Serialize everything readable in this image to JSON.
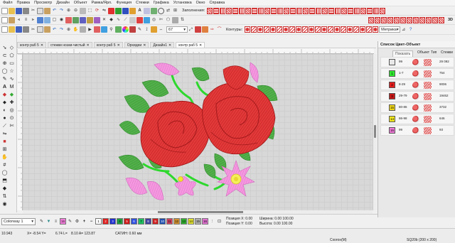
{
  "menu": [
    "Файл",
    "Правка",
    "Просмотр",
    "Дизайн",
    "Объект",
    "Рамка/Ярл.",
    "Функция",
    "Стежки",
    "Графика",
    "Установка",
    "Окно",
    "Справка"
  ],
  "toolbar": {
    "fill_label": "Заполнения:",
    "contour_label": "Контуры:",
    "zoom_value": "67",
    "units_value": "Метрика",
    "label_3d": "3D"
  },
  "tabs": [
    {
      "label": "контр раб 5",
      "active": false
    },
    {
      "label": "стежки ноэки-чистый",
      "active": false
    },
    {
      "label": "контр раб 5",
      "active": false
    },
    {
      "label": "Орхидеи",
      "active": false
    },
    {
      "label": "Дизайн1",
      "active": false
    },
    {
      "label": "контр раб 5",
      "active": true
    }
  ],
  "right_panel": {
    "title": "Список Цвет-Объект",
    "add_button": "Показать",
    "col_object": "Объект",
    "col_type": "Тип",
    "col_stitches": "Стежки",
    "rows": [
      {
        "seq": "99",
        "stitches": "29 092",
        "color": "#e8e8e8",
        "num": ""
      },
      {
        "seq": "1-7",
        "stitches": "754",
        "color": "#2ee62e",
        "num": "1"
      },
      {
        "seq": "8-29",
        "stitches": "9006",
        "color": "#e21d1d",
        "num": "2"
      },
      {
        "seq": "29-79",
        "stitches": "19462",
        "color": "#c41515",
        "num": "3"
      },
      {
        "seq": "80-86",
        "stitches": "3732",
        "color": "#eed61a",
        "num": "15"
      },
      {
        "seq": "86-98",
        "stitches": "646",
        "color": "#f2e81f",
        "num": "14"
      },
      {
        "seq": "99",
        "stitches": "93",
        "color": "#f07ad8",
        "num": "16"
      }
    ]
  },
  "colorbar": {
    "palette_select": "Colorway 1",
    "swatches": [
      {
        "num": "1",
        "color": "#ffffff"
      },
      {
        "num": "2",
        "color": "#e02020"
      },
      {
        "num": "3",
        "color": "#2030d0"
      },
      {
        "num": "4",
        "color": "#20a040"
      },
      {
        "num": "5",
        "color": "#d01818"
      },
      {
        "num": "6",
        "color": "#3050e0"
      },
      {
        "num": "7",
        "color": "#20c060"
      },
      {
        "num": "8",
        "color": "#4040a0"
      },
      {
        "num": "9",
        "color": "#d02020"
      },
      {
        "num": "10",
        "color": "#2050b0"
      },
      {
        "num": "11",
        "color": "#d04060"
      },
      {
        "num": "12",
        "color": "#d09030"
      },
      {
        "num": "13",
        "color": "#30b030"
      },
      {
        "num": "14",
        "color": "#e0e030"
      },
      {
        "num": "15",
        "color": "#b0b0b0"
      },
      {
        "num": "16",
        "color": "#e070d0"
      }
    ],
    "pos_x_label": "Позиция X:",
    "pos_x_value": "0.00",
    "pos_y_label": "Позиция Y:",
    "pos_y_value": "0.00",
    "width_label": "Ширина:",
    "width_value": "0.00",
    "height_label": "Высота:",
    "height_value": "0.00",
    "pct_w": "100.00",
    "pct_h": "100.00"
  },
  "status": {
    "left_value": "10.943",
    "x_value": "X= -8.54 Y=",
    "xy_value": "6.74 L=",
    "l_value": "8.10 A= 123.87",
    "satin": "САТИН: 0.60 мм",
    "mode": "Схогон(М)",
    "hoop": "SQ20b (200 x 200)"
  }
}
